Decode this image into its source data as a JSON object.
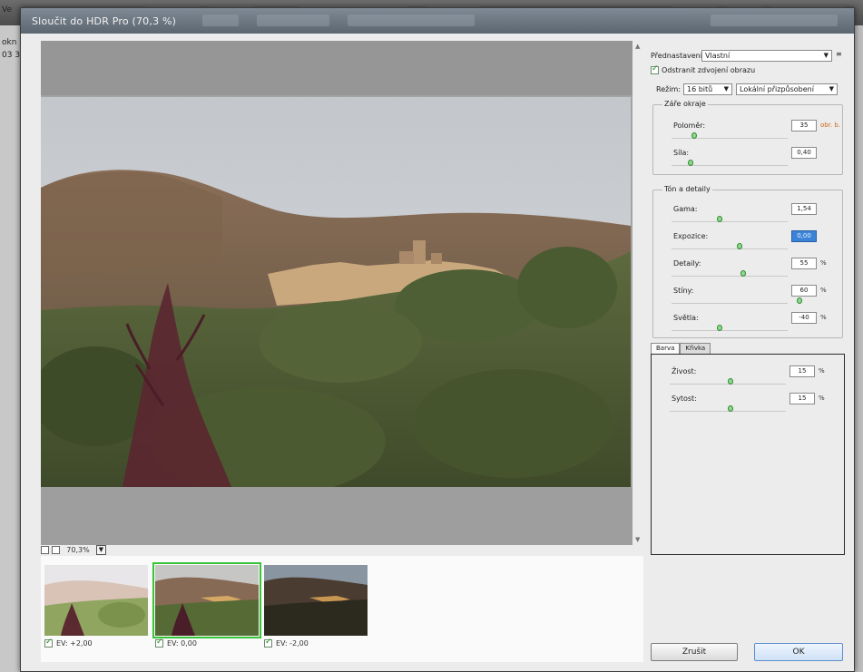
{
  "app": {
    "left_texts": [
      "Ve",
      "okn",
      "03 3"
    ]
  },
  "dialog": {
    "title": "Sloučit do HDR Pro (70,3 %)"
  },
  "preview": {
    "zoom_value": "70,3%",
    "zoom_dropdown_icon": "chevron-down-icon"
  },
  "filmstrip": {
    "items": [
      {
        "ev_label": "EV: +2,00",
        "checked": true,
        "selected": false
      },
      {
        "ev_label": "EV: 0,00",
        "checked": true,
        "selected": true
      },
      {
        "ev_label": "EV: -2,00",
        "checked": true,
        "selected": false
      }
    ]
  },
  "panel": {
    "preset_label": "Přednastavení:",
    "preset_value": "Vlastní",
    "menu_icon": "panel-menu-icon",
    "remove_ghosts_label": "Odstranit zdvojení obrazu",
    "mode_label": "Režim:",
    "mode_value": "16 bitů",
    "method_value": "Lokální přizpůsobení",
    "edge_glow": {
      "title": "Záře okraje",
      "radius": {
        "label": "Poloměr:",
        "value": "35",
        "unit": "obr. b."
      },
      "strength": {
        "label": "Síla:",
        "value": "0,40"
      }
    },
    "tone_detail": {
      "title": "Tón a detaily",
      "gamma": {
        "label": "Gama:",
        "value": "1,54"
      },
      "exposure": {
        "label": "Expozice:",
        "value": "0,00"
      },
      "detail": {
        "label": "Detaily:",
        "value": "55",
        "unit": "%"
      },
      "shadow": {
        "label": "Stíny:",
        "value": "60",
        "unit": "%"
      },
      "highlight": {
        "label": "Světla:",
        "value": "-40",
        "unit": "%"
      }
    },
    "tabs": [
      {
        "label": "Barva",
        "active": true
      },
      {
        "label": "Křivka",
        "active": false
      }
    ],
    "color": {
      "vibrance": {
        "label": "Živost:",
        "value": "15",
        "unit": "%"
      },
      "saturation": {
        "label": "Sytost:",
        "value": "15",
        "unit": "%"
      }
    },
    "cancel_label": "Zrušit",
    "ok_label": "OK"
  },
  "colors": {
    "selected_thumb_border": "#37c437",
    "focused_field": "#3b83d6",
    "slider_knob": "#8fd98f",
    "warn_unit": "#cc6a19"
  }
}
